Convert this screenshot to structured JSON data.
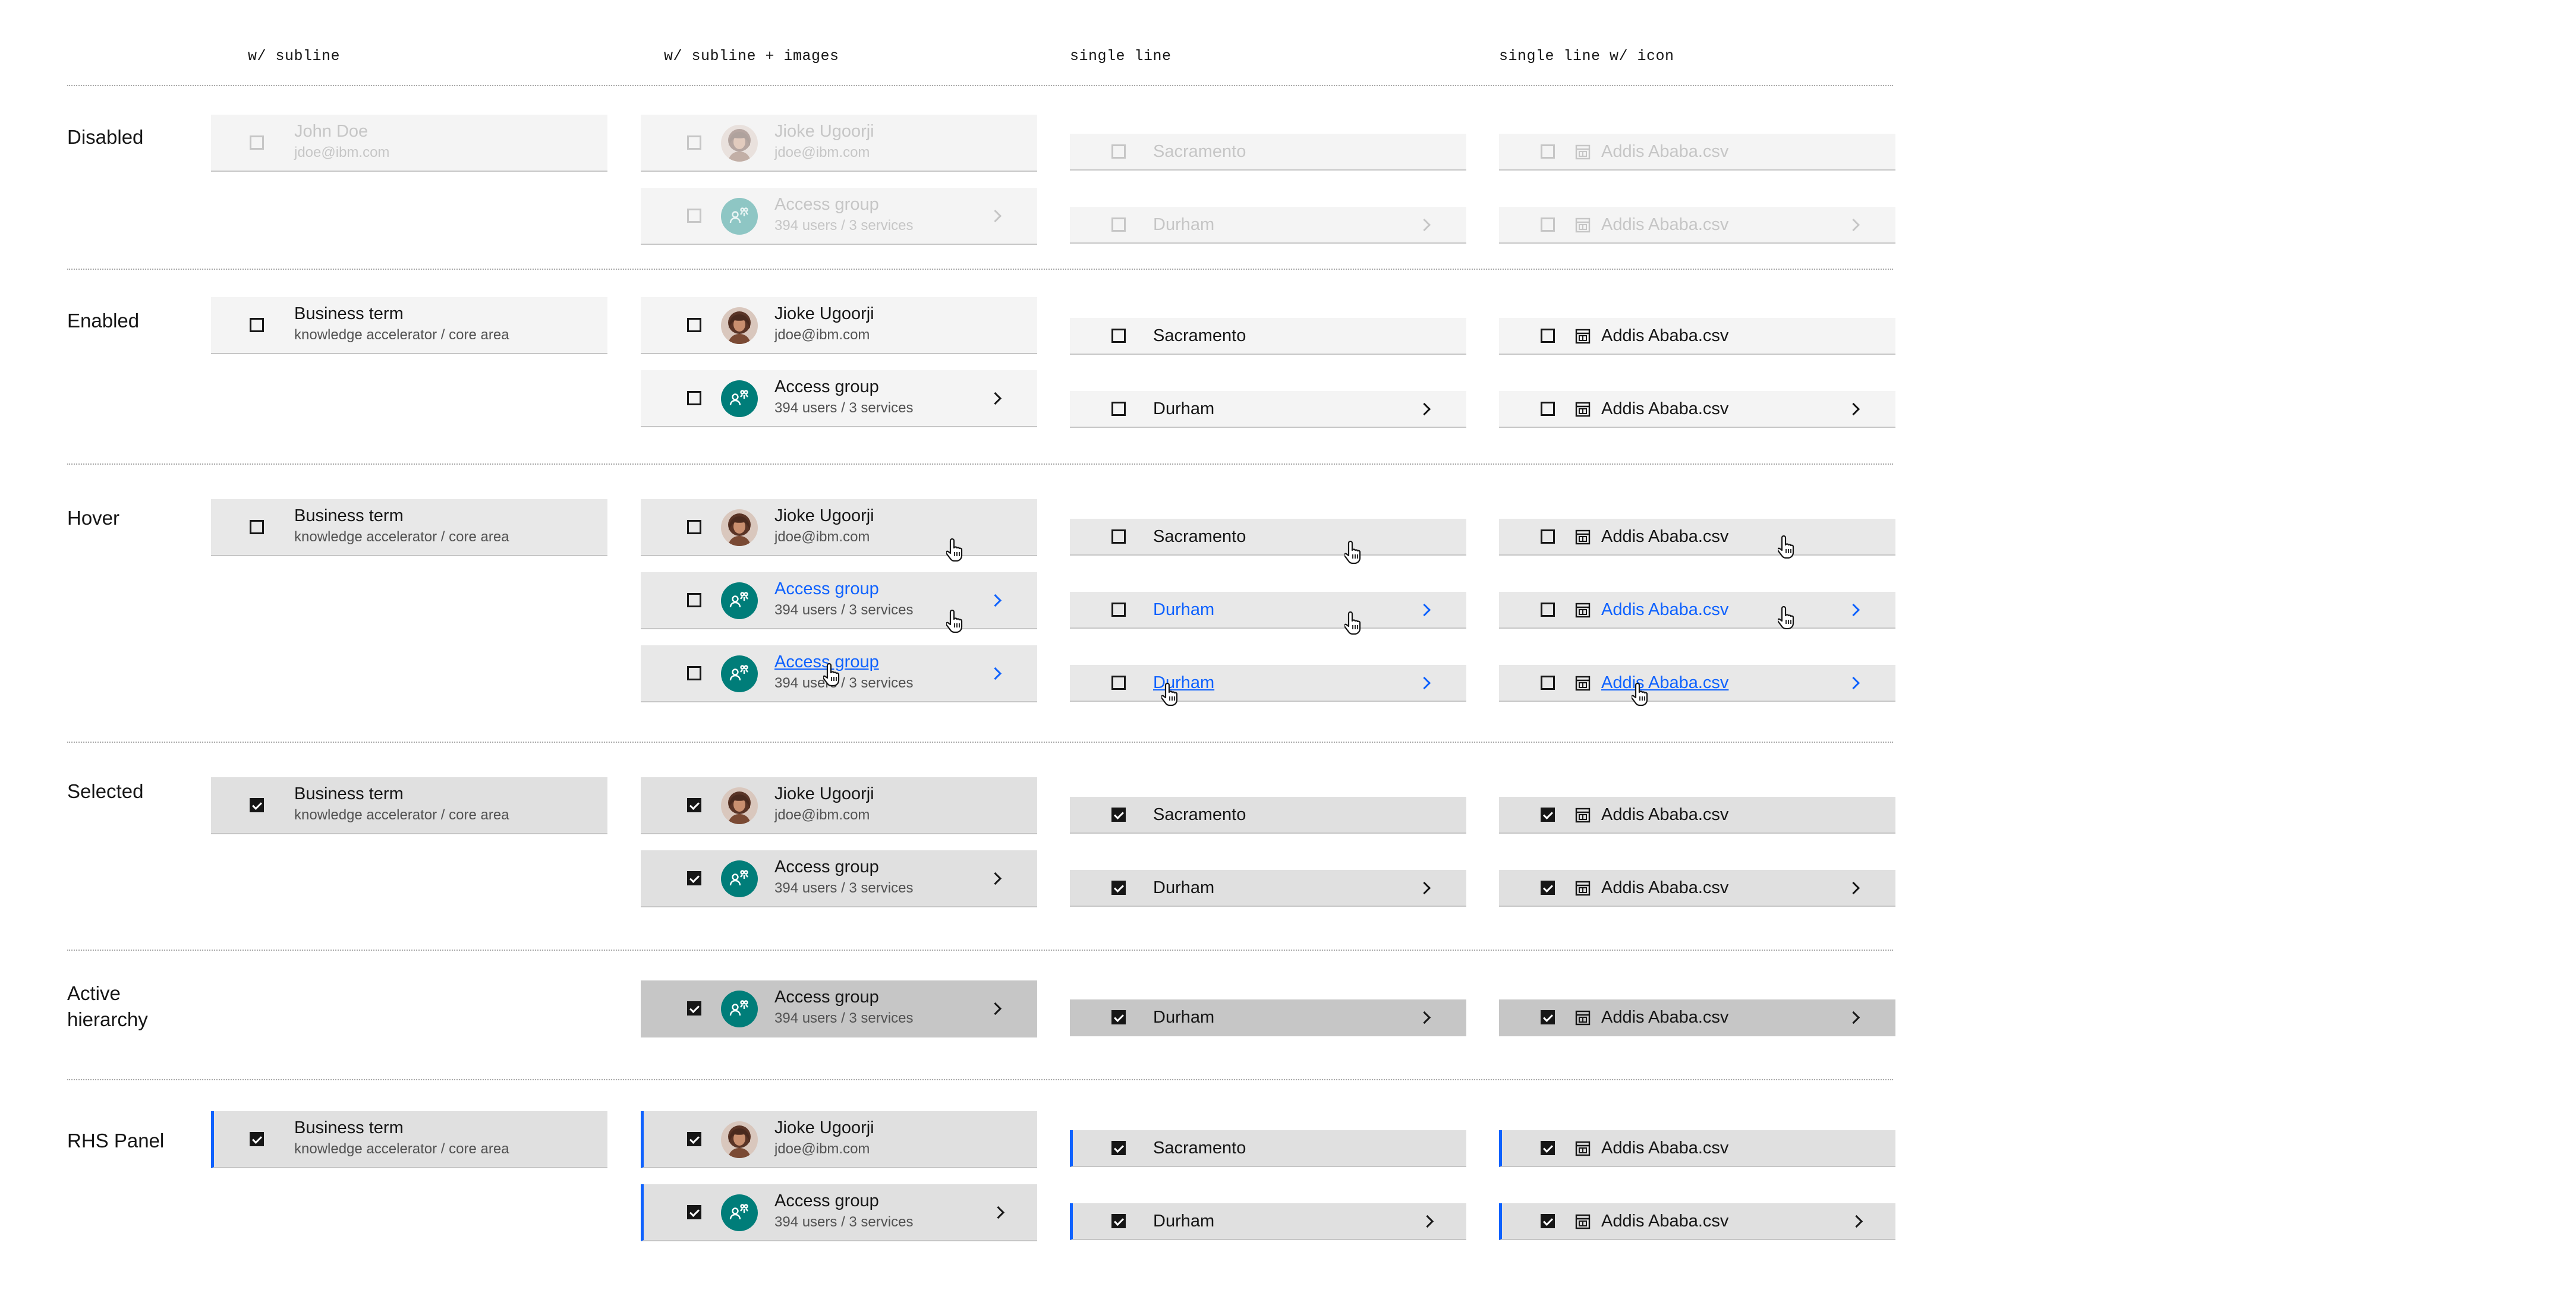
{
  "columns": {
    "subline": "w/ subline",
    "subline_images": "w/ subline + images",
    "single_line": "single line",
    "single_line_icon": "single line w/ icon"
  },
  "rows": {
    "disabled": "Disabled",
    "enabled": "Enabled",
    "hover": "Hover",
    "selected": "Selected",
    "active_hierarchy": "Active\nhierarchy",
    "rhs_panel": "RHS Panel"
  },
  "texts": {
    "john_doe": "John Doe",
    "jdoe": "jdoe@ibm.com",
    "business_term": "Business term",
    "knowledge": "knowledge accelerator / core area",
    "jioke": "Jioke Ugoorji",
    "access_group": "Access group",
    "users_services": "394 users / 3 services",
    "sacramento": "Sacramento",
    "durham": "Durham",
    "addis": "Addis Ababa.csv"
  },
  "icons": {
    "checkbox": "checkbox-icon",
    "chevron": "chevron-right-icon",
    "file": "file-icon",
    "group": "user-group-icon",
    "cursor": "hand-pointer-cursor-icon"
  },
  "colors": {
    "link_blue": "#0f62fe",
    "teal": "#007d79",
    "selected_bg": "#e0e0e0",
    "active_bg": "#c6c6c6"
  }
}
